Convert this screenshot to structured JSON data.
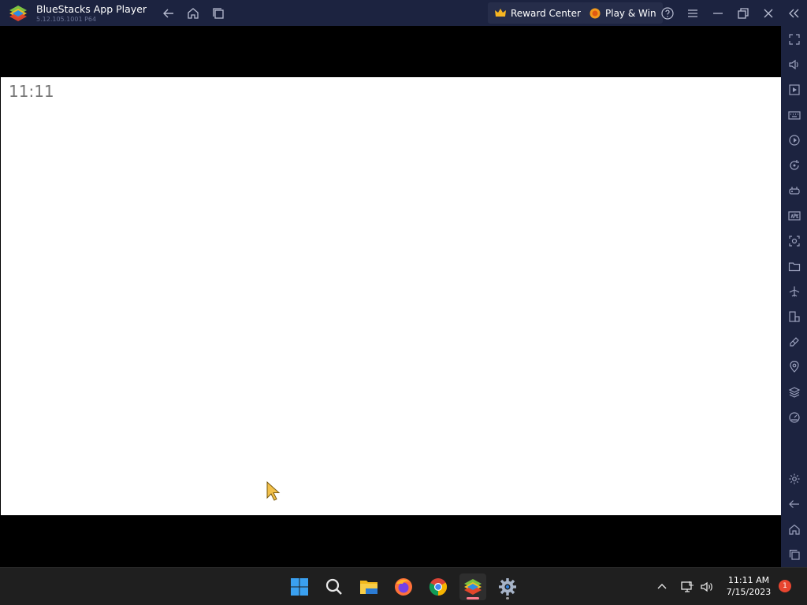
{
  "window": {
    "title": "BlueStacks App Player",
    "version": "5.12.105.1001 P64"
  },
  "header": {
    "reward_center_label": "Reward Center",
    "play_win_label": "Play & Win"
  },
  "screen": {
    "clock": "11:11"
  },
  "taskbar": {
    "time": "11:11 AM",
    "date": "7/15/2023",
    "notification_count": "1"
  },
  "colors": {
    "titlebar_bg": "#1c2340",
    "taskbar_bg": "#1f1f1f",
    "accent_red": "#e8452f"
  },
  "icons": {
    "titlebar": [
      "back-arrow-icon",
      "home-icon",
      "recent-apps-icon",
      "help-icon",
      "menu-icon",
      "minimize-icon",
      "restore-icon",
      "close-icon",
      "collapse-sidebar-icon"
    ],
    "sidebar": [
      "fullscreen-icon",
      "volume-icon",
      "media-icon",
      "keyboard-icon",
      "macro-record-icon",
      "rotate-icon",
      "gamepad-icon",
      "apk-install-icon",
      "screenshot-icon",
      "folder-icon",
      "airplane-mode-icon",
      "multi-instance-icon",
      "eco-mode-icon",
      "location-icon",
      "layers-icon",
      "speed-icon",
      "settings-icon",
      "back-icon",
      "home-icon",
      "recent-icon"
    ],
    "taskbar": [
      "windows-start-icon",
      "search-icon",
      "file-explorer-icon",
      "firefox-icon",
      "chrome-icon",
      "bluestacks-icon",
      "settings-gear-icon"
    ]
  }
}
